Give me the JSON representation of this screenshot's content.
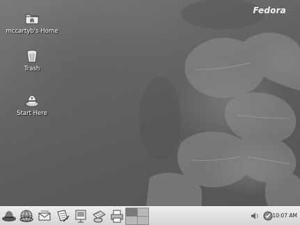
{
  "brand": {
    "text": "Fedora"
  },
  "desktop_icons": [
    {
      "name": "home-folder",
      "label": "mccartyb's Home",
      "icon": "home-folder-icon"
    },
    {
      "name": "trash",
      "label": "Trash",
      "icon": "trash-icon"
    },
    {
      "name": "start-here",
      "label": "Start Here",
      "icon": "start-here-icon"
    }
  ],
  "panel": {
    "launchers": [
      {
        "name": "main-menu",
        "icon": "fedora-hat-icon"
      },
      {
        "name": "web-browser",
        "icon": "globe-icon"
      },
      {
        "name": "email",
        "icon": "email-icon"
      },
      {
        "name": "writer",
        "icon": "document-icon"
      },
      {
        "name": "impress",
        "icon": "presentation-icon"
      },
      {
        "name": "calc",
        "icon": "spreadsheet-icon"
      },
      {
        "name": "print",
        "icon": "printer-icon"
      }
    ],
    "workspaces": {
      "count": 4,
      "active": 1
    },
    "tray": [
      {
        "name": "volume",
        "icon": "speaker-icon"
      },
      {
        "name": "update",
        "icon": "update-check-icon"
      }
    ],
    "clock": "10:07 AM"
  }
}
